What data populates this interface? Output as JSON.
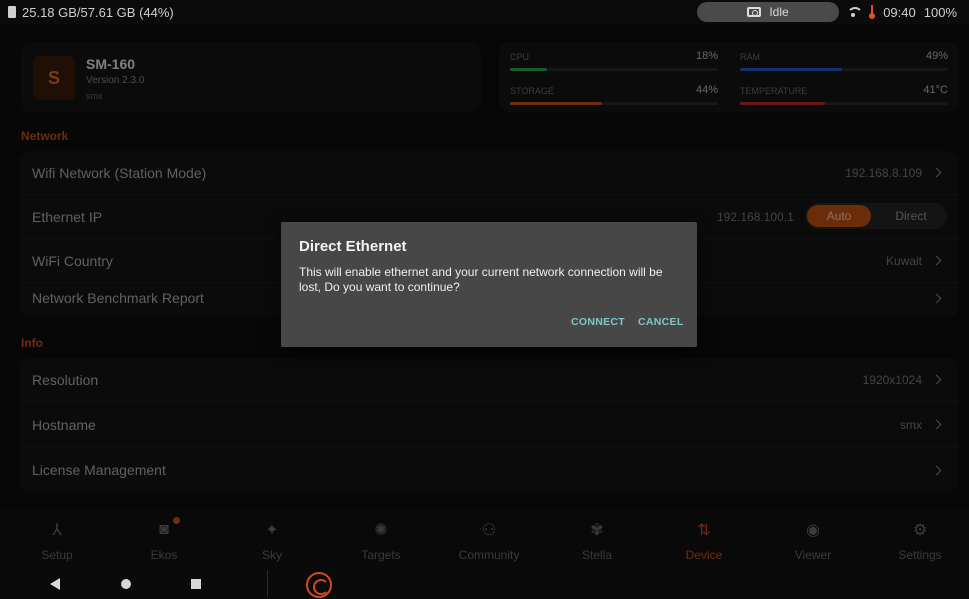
{
  "status_bar": {
    "storage": "25.18 GB/57.61 GB (44%)",
    "camera_status": "Idle",
    "time": "09:40",
    "battery": "100%"
  },
  "device": {
    "avatar_letter": "S",
    "name": "SM-160",
    "version": "Version 2.3.0",
    "hostname": "smx"
  },
  "stats": {
    "cpu": {
      "label": "CPU",
      "value": "18%",
      "fraction": 0.18,
      "color": "#2aa84a"
    },
    "ram": {
      "label": "RAM",
      "value": "49%",
      "fraction": 0.49,
      "color": "#2356c9"
    },
    "storage": {
      "label": "STORAGE",
      "value": "44%",
      "fraction": 0.44,
      "color": "#c9541b"
    },
    "temperature": {
      "label": "TEMPERATURE",
      "value": "41°C",
      "fraction": 0.41,
      "color": "#c9282b"
    }
  },
  "network": {
    "section_label": "Network",
    "wifi": {
      "label": "Wifi Network (Station Mode)",
      "value": "192.168.8.109"
    },
    "ethernet": {
      "label": "Ethernet IP",
      "value": "192.168.100.1",
      "mode_auto": "Auto",
      "mode_direct": "Direct",
      "selected": "Auto"
    },
    "wifi_country": {
      "label": "WiFi Country",
      "value": "Kuwait"
    },
    "benchmark": {
      "label": "Network Benchmark Report"
    }
  },
  "info": {
    "section_label": "Info",
    "resolution": {
      "label": "Resolution",
      "value": "1920x1024"
    },
    "hostname": {
      "label": "Hostname",
      "value": "smx"
    },
    "license": {
      "label": "License Management"
    }
  },
  "dialog": {
    "title": "Direct Ethernet",
    "message": "This will enable ethernet and your current network connection will be lost, Do you want to continue?",
    "confirm": "CONNECT",
    "cancel": "CANCEL"
  },
  "bottom_nav": [
    {
      "label": "Setup",
      "icon": "setup-icon"
    },
    {
      "label": "Ekos",
      "icon": "ekos-icon"
    },
    {
      "label": "Sky",
      "icon": "sky-icon"
    },
    {
      "label": "Targets",
      "icon": "targets-icon"
    },
    {
      "label": "Community",
      "icon": "community-icon"
    },
    {
      "label": "Stella",
      "icon": "stella-icon"
    },
    {
      "label": "Device",
      "icon": "device-icon"
    },
    {
      "label": "Viewer",
      "icon": "viewer-icon"
    },
    {
      "label": "Settings",
      "icon": "settings-icon"
    }
  ],
  "active_nav": "Device",
  "accent_color": "#c94d1a"
}
